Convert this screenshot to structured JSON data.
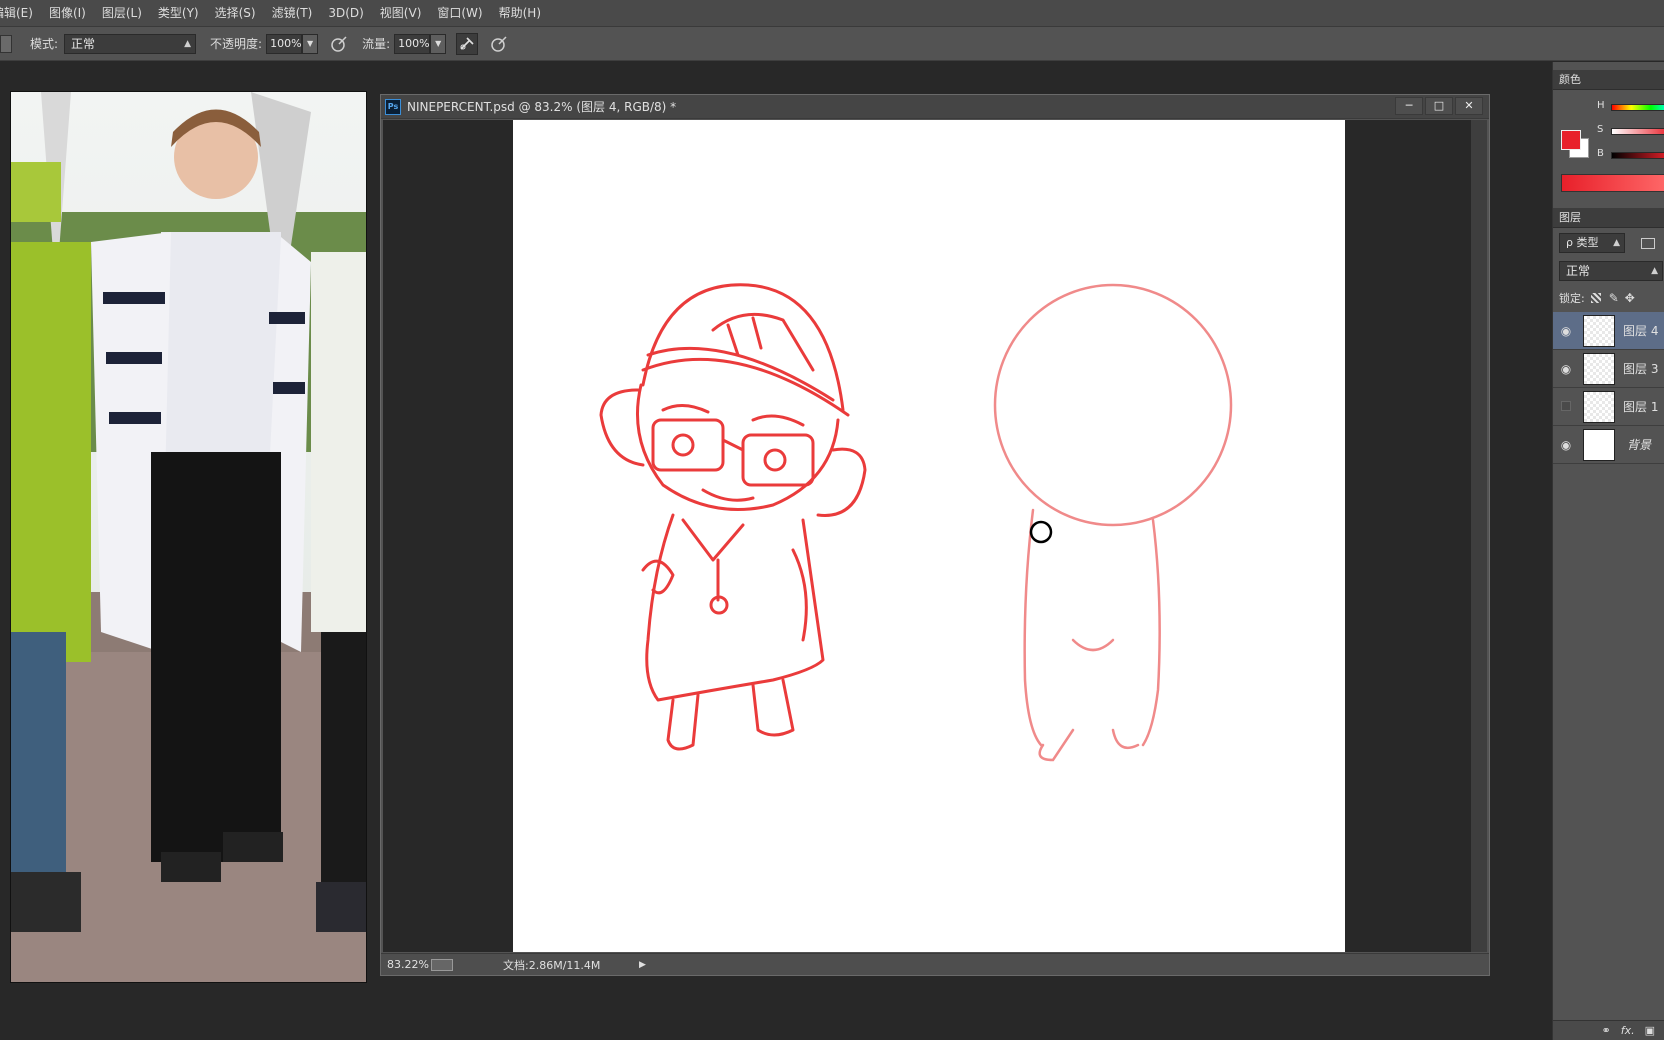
{
  "menubar": {
    "items": [
      "编辑(E)",
      "图像(I)",
      "图层(L)",
      "类型(Y)",
      "选择(S)",
      "滤镜(T)",
      "3D(D)",
      "视图(V)",
      "窗口(W)",
      "帮助(H)"
    ]
  },
  "options": {
    "mode_label": "模式:",
    "mode_value": "正常",
    "opacity_label": "不透明度:",
    "opacity_value": "100%",
    "flow_label": "流量:",
    "flow_value": "100%"
  },
  "document": {
    "title": "NINEPERCENT.psd @ 83.2% (图层 4, RGB/8) *",
    "ps_badge": "Ps",
    "zoom": "83.22%",
    "doc_size": "文档:2.86M/11.4M"
  },
  "panels": {
    "color_tab": "颜色",
    "layers_tab": "图层",
    "h_label": "H",
    "s_label": "S",
    "b_label": "B",
    "filter_kind": "ρ 类型",
    "blend_mode": "正常",
    "lock_label": "锁定:",
    "foreground_color": "#e8202a",
    "background_color": "#ffffff",
    "layers": [
      {
        "name": "图层 4",
        "visible": true,
        "selected": true
      },
      {
        "name": "图层 3",
        "visible": true,
        "selected": false
      },
      {
        "name": "图层 1",
        "visible": false,
        "selected": false
      },
      {
        "name": "背景",
        "visible": true,
        "selected": false
      }
    ]
  }
}
